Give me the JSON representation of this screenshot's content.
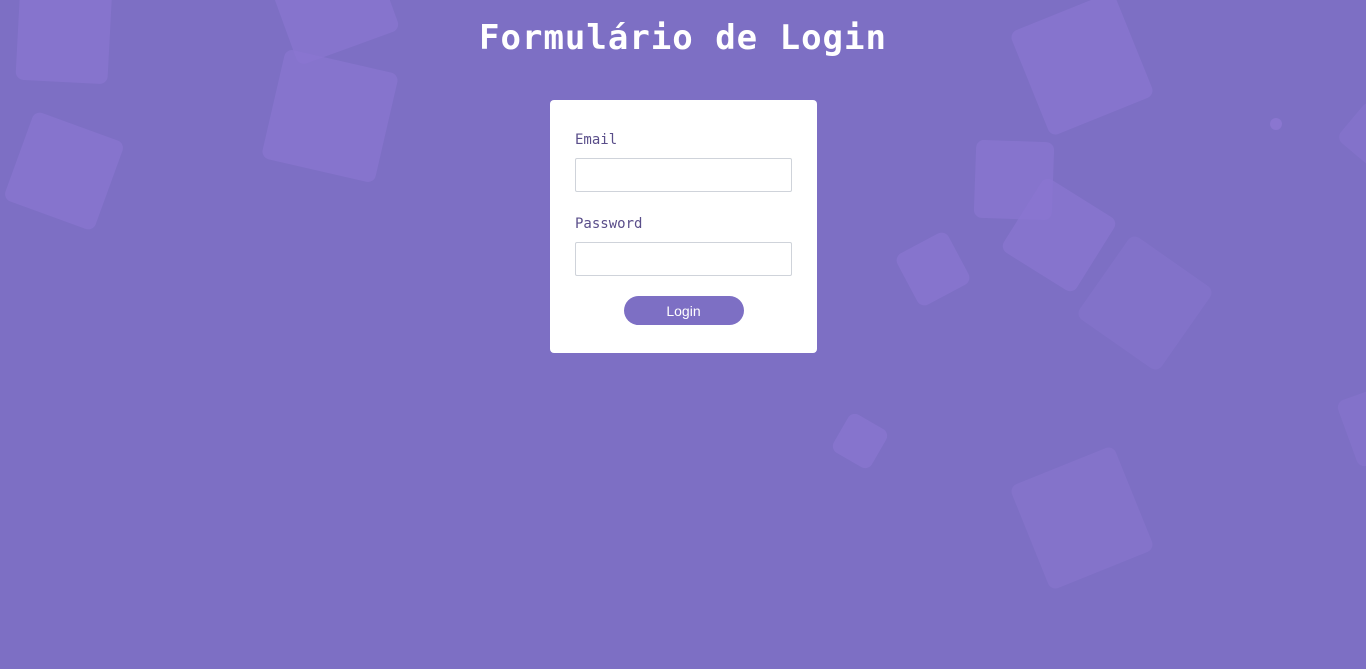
{
  "page": {
    "title": "Formulário de Login",
    "background_color": "#7d6fc4",
    "accent_color": "#7d6fc4"
  },
  "form": {
    "email_label": "Email",
    "email_value": "",
    "password_label": "Password",
    "password_value": "",
    "login_button_label": "Login"
  }
}
